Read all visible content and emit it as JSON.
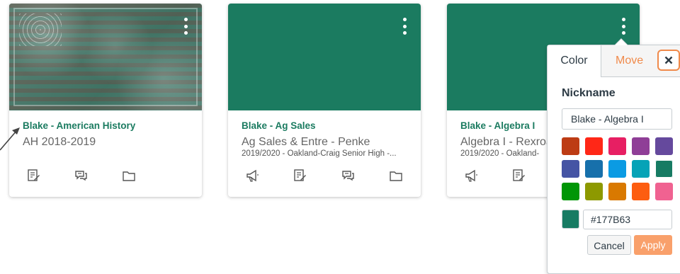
{
  "cards": [
    {
      "title": "Blake - American History",
      "subtitle": "AH 2018-2019",
      "term": "",
      "has_image": true,
      "color": "#1b7b60",
      "actions": [
        "assignments-icon",
        "discussions-icon",
        "files-icon"
      ]
    },
    {
      "title": "Blake - Ag Sales",
      "subtitle": "Ag Sales & Entre - Penke",
      "term": "2019/2020 - Oakland-Craig Senior High -...",
      "has_image": false,
      "color": "#1b7b60",
      "actions": [
        "announcements-icon",
        "assignments-icon",
        "discussions-icon",
        "files-icon"
      ]
    },
    {
      "title": "Blake - Algebra I",
      "subtitle": "Algebra I - Rexroa",
      "term": "2019/2020 - Oakland-",
      "has_image": false,
      "color": "#1b7b60",
      "actions": [
        "announcements-icon",
        "assignments-icon"
      ]
    }
  ],
  "popover": {
    "tab_color": "Color",
    "tab_move": "Move",
    "close_icon": "close-icon",
    "nickname_label": "Nickname",
    "nickname_value": "Blake - Algebra I",
    "swatches": [
      "#BD3C14",
      "#FF2717",
      "#E71F63",
      "#8F3E97",
      "#65499D",
      "#4554A4",
      "#1770AB",
      "#0B9BE3",
      "#06A3B7",
      "#177B63",
      "#009606",
      "#8D9900",
      "#D97900",
      "#FD5D10",
      "#F06291"
    ],
    "selected_swatch": "#177B63",
    "hex_value": "#177B63",
    "cancel_label": "Cancel",
    "apply_label": "Apply"
  },
  "colors": {
    "brand_green": "#1b7b60",
    "accent_orange": "#f08a4b",
    "apply_orange": "#f9a06b"
  }
}
